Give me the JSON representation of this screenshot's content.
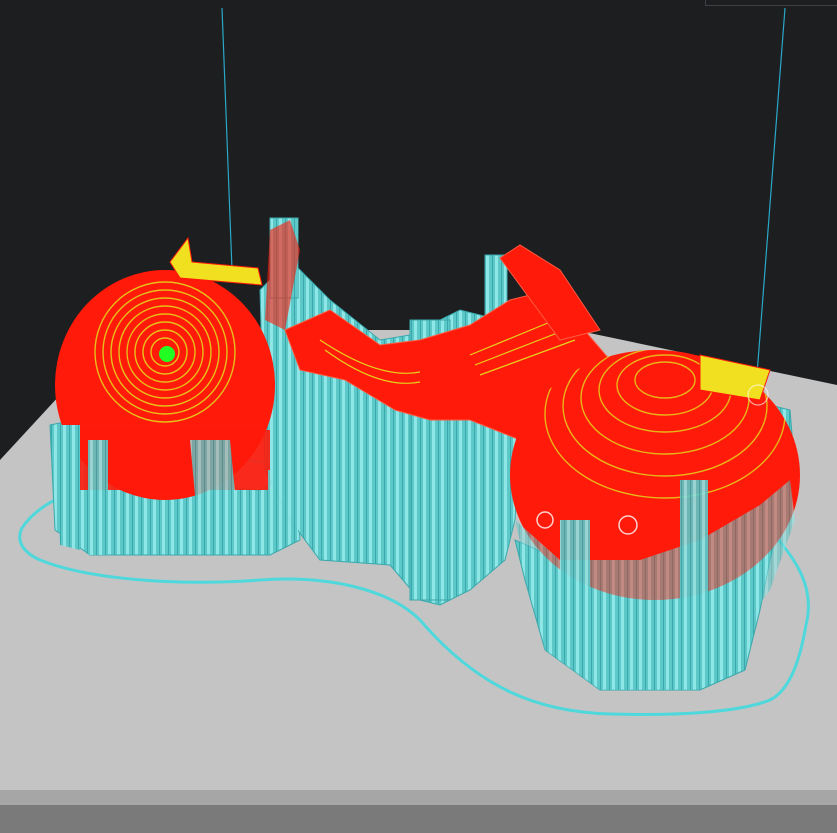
{
  "viewport": {
    "background": "#1c1e20",
    "build_plate_color": "#c4c4c4",
    "build_plate_edge_color": "#8e8e8e",
    "build_volume_line_color": "#2aa8c8"
  },
  "print_preview": {
    "support_color": "#5fd3d3",
    "model_wall_color": "#ff1a0a",
    "infill_top_color": "#f0e020",
    "skirt_color": "#4fd8dc",
    "layer_start_marker_color": "#22ff22"
  }
}
